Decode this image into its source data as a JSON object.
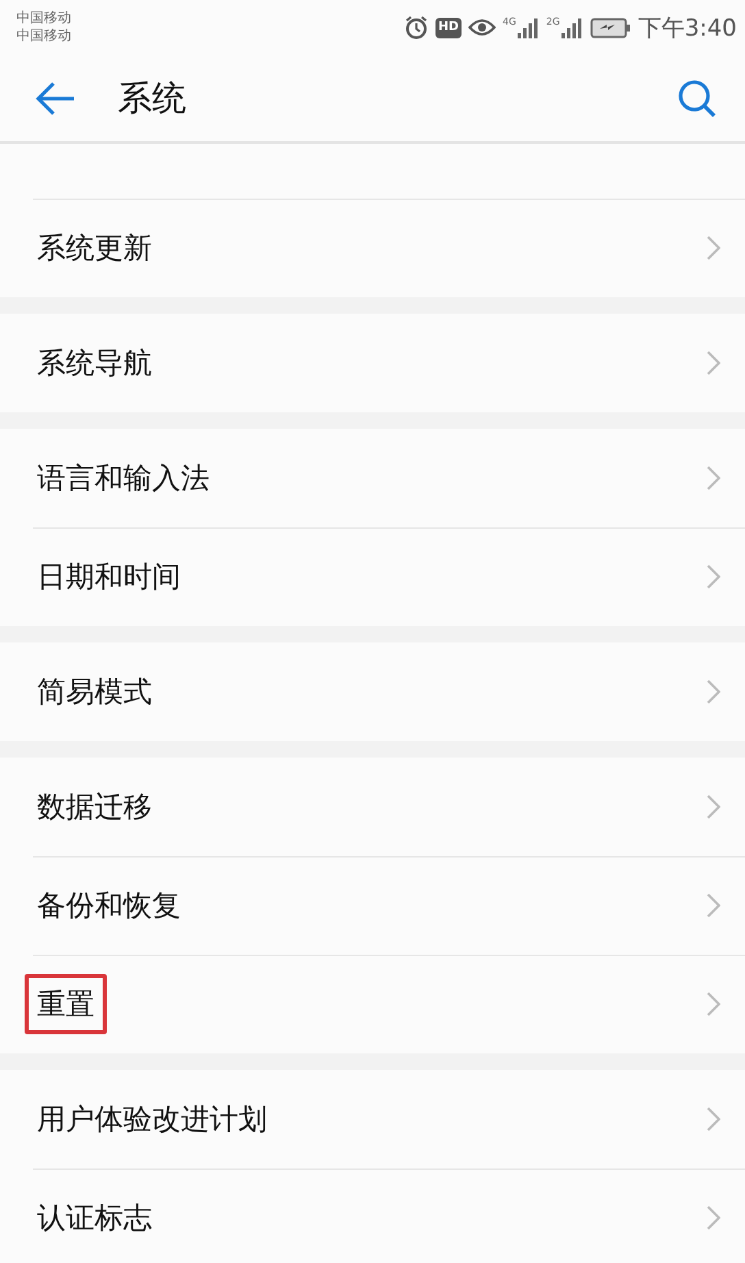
{
  "status_bar": {
    "carriers": [
      "中国移动",
      "中国移动"
    ],
    "hd_badge": "HD",
    "networks": [
      "4G",
      "2G"
    ],
    "time": "下午3:40"
  },
  "header": {
    "title": "系统"
  },
  "groups": [
    {
      "items": [
        {
          "label": "系统更新",
          "highlighted": false
        }
      ]
    },
    {
      "items": [
        {
          "label": "系统导航",
          "highlighted": false
        }
      ]
    },
    {
      "items": [
        {
          "label": "语言和输入法",
          "highlighted": false
        },
        {
          "label": "日期和时间",
          "highlighted": false
        }
      ]
    },
    {
      "items": [
        {
          "label": "简易模式",
          "highlighted": false
        }
      ]
    },
    {
      "items": [
        {
          "label": "数据迁移",
          "highlighted": false
        },
        {
          "label": "备份和恢复",
          "highlighted": false
        },
        {
          "label": "重置",
          "highlighted": true
        }
      ]
    },
    {
      "items": [
        {
          "label": "用户体验改进计划",
          "highlighted": false
        },
        {
          "label": "认证标志",
          "highlighted": false
        }
      ]
    }
  ]
}
